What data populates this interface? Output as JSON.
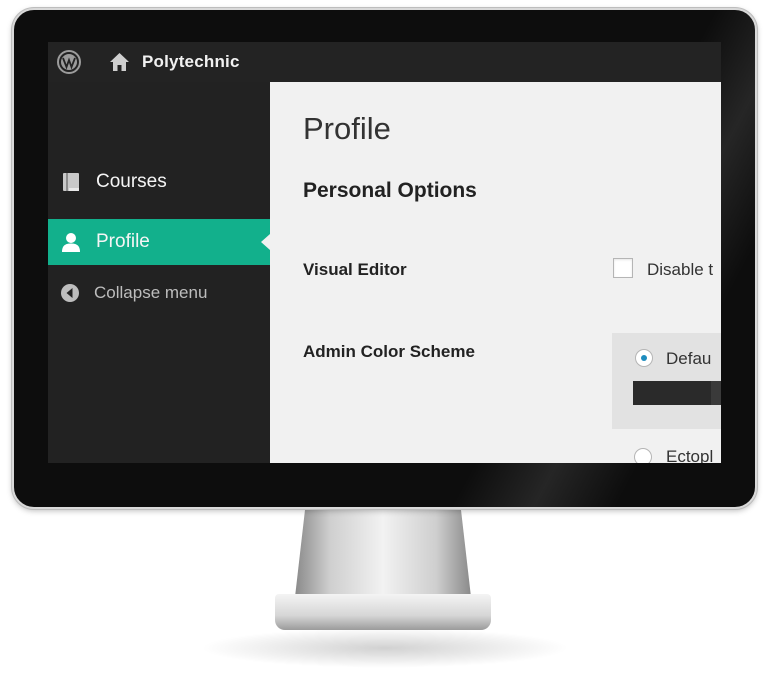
{
  "topbar": {
    "site_name": "Polytechnic"
  },
  "sidebar": {
    "items": [
      {
        "label": "Courses",
        "icon": "book-icon",
        "active": false
      },
      {
        "label": "Profile",
        "icon": "user-icon",
        "active": true
      }
    ],
    "collapse_label": "Collapse menu"
  },
  "main": {
    "page_title": "Profile",
    "section_title": "Personal Options",
    "visual_editor": {
      "label": "Visual Editor",
      "checkbox_text": "Disable t",
      "checked": false
    },
    "color_scheme": {
      "label": "Admin Color Scheme",
      "options": [
        {
          "label": "Defau",
          "selected": true
        },
        {
          "label": "Ectopl",
          "selected": false
        }
      ]
    }
  },
  "colors": {
    "accent": "#12b08c",
    "sidebar_bg": "#222222",
    "content_bg": "#f1f1f1",
    "radio_dot": "#1e8cbe"
  }
}
